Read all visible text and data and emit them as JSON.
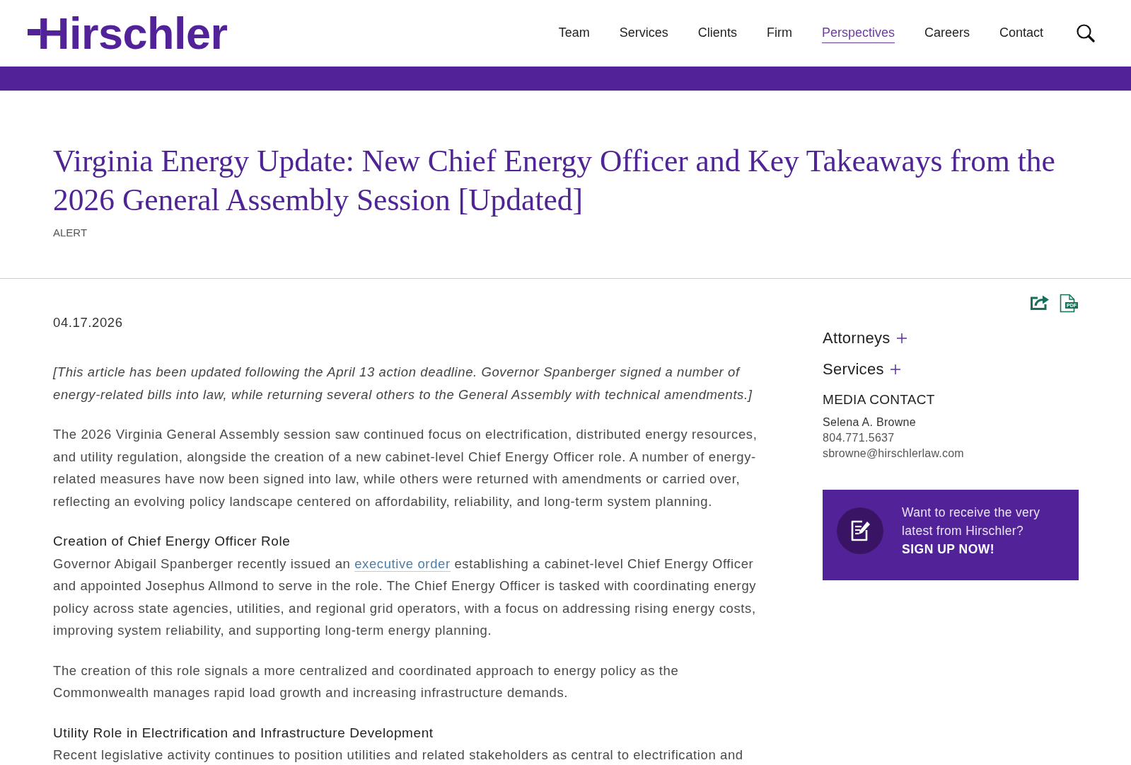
{
  "header": {
    "logo": "Hirschler",
    "nav": [
      {
        "label": "Team",
        "selected": false
      },
      {
        "label": "Services",
        "selected": false
      },
      {
        "label": "Clients",
        "selected": false
      },
      {
        "label": "Firm",
        "selected": false
      },
      {
        "label": "Perspectives",
        "selected": true
      },
      {
        "label": "Careers",
        "selected": false
      },
      {
        "label": "Contact",
        "selected": false
      }
    ]
  },
  "article": {
    "title": "Virginia Energy Update: New Chief Energy Officer and Key Takeaways from the 2026 General Assembly Session [Updated]",
    "category": "ALERT",
    "date": "04.17.2026",
    "body": [
      {
        "kind": "note",
        "segments": [
          {
            "kind": "text",
            "text": "[This article has been updated following the April 13 action deadline. Governor Spanberger signed a number of energy-related bills into law, while returning several others to the General Assembly with technical amendments.]"
          }
        ]
      },
      {
        "kind": "paragraph",
        "segments": [
          {
            "kind": "text",
            "text": "The 2026 Virginia General Assembly session saw continued focus on electrification, distributed energy resources, and utility regulation, alongside the creation of a new cabinet-level Chief Energy Officer role. A number of energy-related measures have now been signed into law, while others were returned with amendments or carried over, reflecting an evolving policy landscape centered on affordability, reliability, and long-term system planning."
          }
        ]
      },
      {
        "kind": "heading",
        "segments": [
          {
            "kind": "text",
            "text": "Creation of Chief Energy Officer Role"
          }
        ]
      },
      {
        "kind": "paragraph",
        "segments": [
          {
            "kind": "text",
            "text": "Governor Abigail Spanberger recently issued an "
          },
          {
            "kind": "link",
            "text": "executive order"
          },
          {
            "kind": "text",
            "text": " establishing a cabinet-level Chief Energy Officer and appointed Josephus Allmond to serve in the role. The Chief Energy Officer is tasked with coordinating energy policy across state agencies, utilities, and regional grid operators, with a focus on addressing rising energy costs, improving system reliability, and supporting long-term energy planning."
          }
        ]
      },
      {
        "kind": "paragraph",
        "segments": [
          {
            "kind": "text",
            "text": "The creation of this role signals a more centralized and coordinated approach to energy policy as the Commonwealth manages rapid load growth and increasing infrastructure demands."
          }
        ]
      },
      {
        "kind": "heading",
        "segments": [
          {
            "kind": "text",
            "text": "Utility Role in Electrification and Infrastructure Development"
          }
        ]
      },
      {
        "kind": "paragraph",
        "segments": [
          {
            "kind": "text",
            "text": "Recent legislative activity continues to position utilities and related stakeholders as central to electrification and"
          }
        ]
      }
    ]
  },
  "sidebar": {
    "pdf_label": "PDF",
    "accordions": [
      {
        "label": "Attorneys",
        "expanded": false
      },
      {
        "label": "Services",
        "expanded": false
      }
    ],
    "media_contact": {
      "heading": "MEDIA CONTACT",
      "name": "Selena A. Browne",
      "phone": "804.771.5637",
      "email": "sbrowne@hirschlerlaw.com"
    },
    "newsletter": {
      "prompt": "Want to receive the very latest from Hirschler?",
      "action": "SIGN UP NOW!"
    }
  }
}
